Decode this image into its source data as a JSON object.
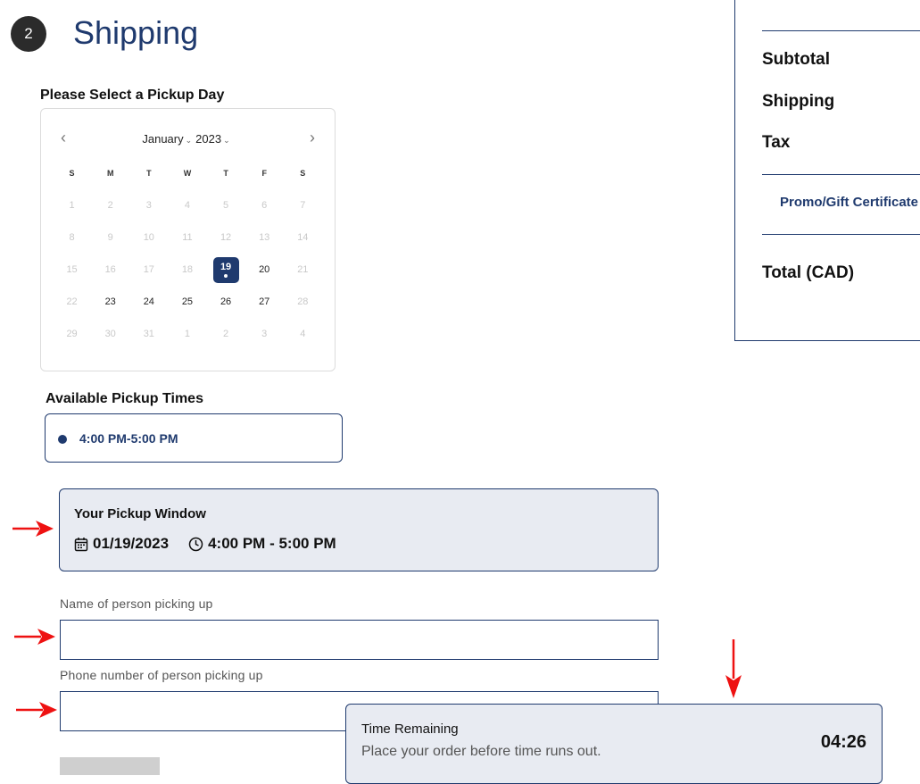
{
  "step": {
    "number": "2",
    "title": "Shipping"
  },
  "calendar": {
    "label": "Please Select a Pickup Day",
    "month": "January",
    "year": "2023",
    "weekdays": [
      "S",
      "M",
      "T",
      "W",
      "T",
      "F",
      "S"
    ],
    "weeks": [
      [
        {
          "d": "1",
          "dis": true
        },
        {
          "d": "2",
          "dis": true
        },
        {
          "d": "3",
          "dis": true
        },
        {
          "d": "4",
          "dis": true
        },
        {
          "d": "5",
          "dis": true
        },
        {
          "d": "6",
          "dis": true
        },
        {
          "d": "7",
          "dis": true
        }
      ],
      [
        {
          "d": "8",
          "dis": true
        },
        {
          "d": "9",
          "dis": true
        },
        {
          "d": "10",
          "dis": true
        },
        {
          "d": "11",
          "dis": true
        },
        {
          "d": "12",
          "dis": true
        },
        {
          "d": "13",
          "dis": true
        },
        {
          "d": "14",
          "dis": true
        }
      ],
      [
        {
          "d": "15",
          "dis": true
        },
        {
          "d": "16",
          "dis": true
        },
        {
          "d": "17",
          "dis": true
        },
        {
          "d": "18",
          "dis": true
        },
        {
          "d": "19",
          "sel": true
        },
        {
          "d": "20"
        },
        {
          "d": "21",
          "dis": true
        }
      ],
      [
        {
          "d": "22",
          "dis": true
        },
        {
          "d": "23"
        },
        {
          "d": "24"
        },
        {
          "d": "25"
        },
        {
          "d": "26"
        },
        {
          "d": "27"
        },
        {
          "d": "28",
          "dis": true
        }
      ],
      [
        {
          "d": "29",
          "dis": true
        },
        {
          "d": "30",
          "dis": true
        },
        {
          "d": "31",
          "dis": true
        },
        {
          "d": "1",
          "dis": true
        },
        {
          "d": "2",
          "dis": true
        },
        {
          "d": "3",
          "dis": true
        },
        {
          "d": "4",
          "dis": true
        }
      ]
    ]
  },
  "pickup_times": {
    "label": "Available Pickup Times",
    "options": [
      "4:00 PM-5:00 PM"
    ]
  },
  "pickup_window": {
    "title": "Your Pickup Window",
    "date": "01/19/2023",
    "time": "4:00 PM - 5:00 PM"
  },
  "form": {
    "name_label": "Name of person picking up",
    "name_value": "",
    "phone_label": "Phone number of person picking up",
    "phone_value": ""
  },
  "summary": {
    "subtotal_label": "Subtotal",
    "shipping_label": "Shipping",
    "tax_label": "Tax",
    "promo_label": "Promo/Gift Certificate",
    "total_label": "Total (CAD)"
  },
  "timer": {
    "title": "Time Remaining",
    "subtitle": "Place your order before time runs out.",
    "countdown": "04:26"
  },
  "colors": {
    "accent": "#1f3a6e",
    "panel_bg": "#e8ebf2",
    "annotation": "#ee1111"
  }
}
